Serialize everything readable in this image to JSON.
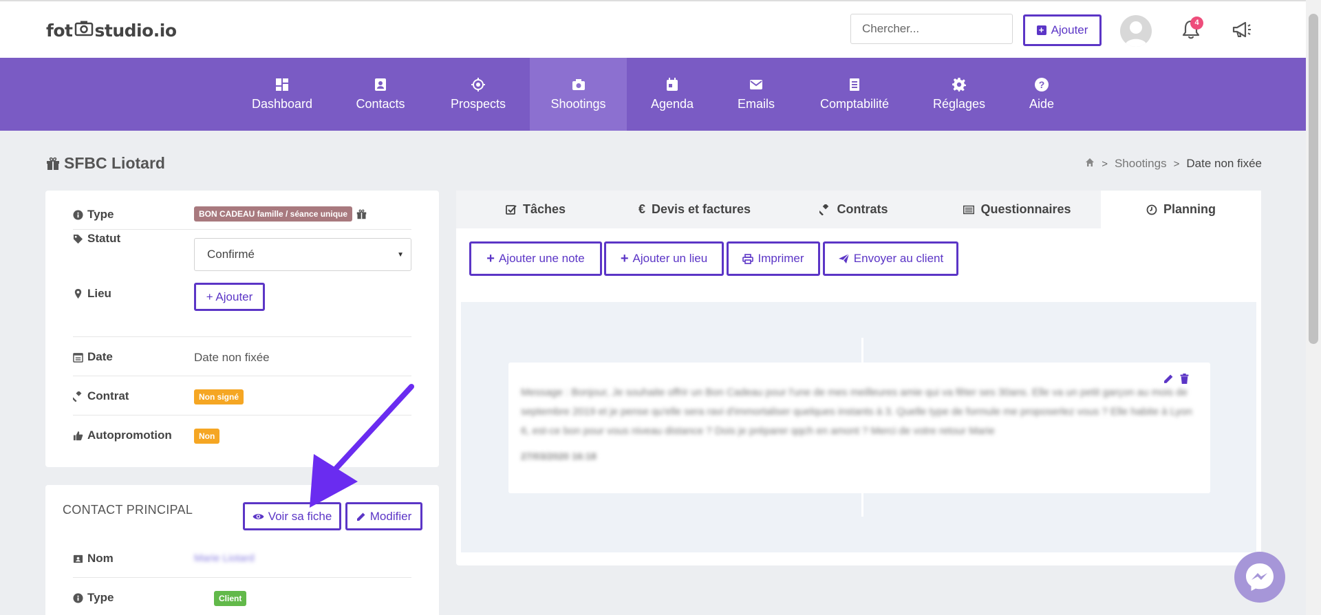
{
  "brand": {
    "logo_prefix": "fot",
    "logo_suffix": "studio.io"
  },
  "header": {
    "search_placeholder": "Chercher...",
    "add_label": "Ajouter",
    "notification_count": "4"
  },
  "nav": {
    "items": [
      {
        "label": "Dashboard"
      },
      {
        "label": "Contacts"
      },
      {
        "label": "Prospects"
      },
      {
        "label": "Shootings"
      },
      {
        "label": "Agenda"
      },
      {
        "label": "Emails"
      },
      {
        "label": "Comptabilité"
      },
      {
        "label": "Réglages"
      },
      {
        "label": "Aide"
      }
    ],
    "active": "Shootings"
  },
  "page": {
    "title": "SFBC Liotard",
    "breadcrumb": [
      "Shootings",
      "Date non fixée"
    ]
  },
  "info": {
    "type_label": "Type",
    "type_value": "BON CADEAU famille / séance unique",
    "statut_label": "Statut",
    "statut_value": "Confirmé",
    "lieu_label": "Lieu",
    "lieu_button": "+ Ajouter",
    "date_label": "Date",
    "date_value": "Date non fixée",
    "contrat_label": "Contrat",
    "contrat_value": "Non signé",
    "autopromo_label": "Autopromotion",
    "autopromo_value": "Non"
  },
  "contact": {
    "heading": "CONTACT PRINCIPAL",
    "view_button": "Voir sa fiche",
    "edit_button": "Modifier",
    "nom_label": "Nom",
    "nom_value": "Marie Liotard",
    "type_label": "Type",
    "type_value": "Client"
  },
  "tabs": [
    {
      "label": "Tâches"
    },
    {
      "label": "Devis et factures"
    },
    {
      "label": "Contrats"
    },
    {
      "label": "Questionnaires"
    },
    {
      "label": "Planning"
    }
  ],
  "actions": {
    "add_note": "Ajouter une note",
    "add_place": "Ajouter un lieu",
    "print": "Imprimer",
    "send": "Envoyer au client"
  },
  "note": {
    "text": "Message : Bonjour, Je souhaite offrir un Bon Cadeau pour l'une de mes meilleures amie qui va fêter ses 30ans. Elle va un petit garçon au mois de septembre 2019 et je pense qu'elle sera ravi d'immortaliser quelques instants à 3. Quelle type de formule me proposerlez vous ? Elle habite à Lyon 6, est-ce bon pour vous niveau distance ? Dois je préparer qqch en amont ? Merci de votre retour Marie",
    "date": "27/03/2020 16:18"
  },
  "colors": {
    "accent": "#5b35c6",
    "nav_bg": "#7a5bc4",
    "nav_active": "#8c70d0"
  }
}
